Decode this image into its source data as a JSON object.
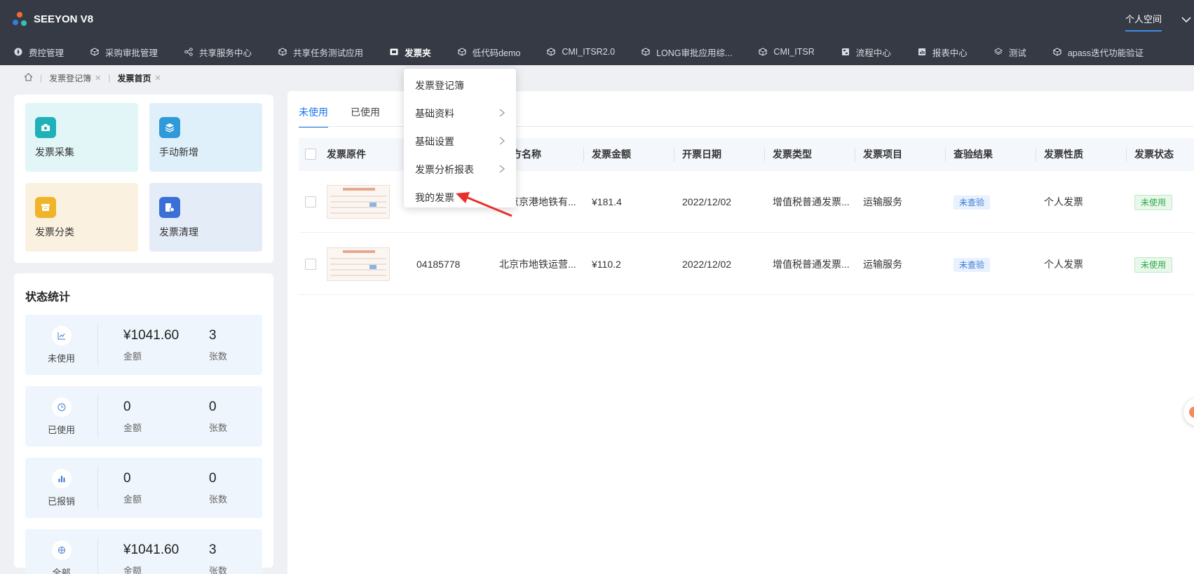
{
  "brand": {
    "name": "SEEYON V8"
  },
  "topbar": {
    "personal_space": "个人空间"
  },
  "nav": {
    "items": [
      {
        "label": "费控管理",
        "icon": "compass-icon"
      },
      {
        "label": "采购审批管理",
        "icon": "cube-icon"
      },
      {
        "label": "共享服务中心",
        "icon": "share-icon"
      },
      {
        "label": "共享任务测试应用",
        "icon": "cube-icon"
      },
      {
        "label": "发票夹",
        "icon": "invoice-folder-icon"
      },
      {
        "label": "低代码demo",
        "icon": "cube-icon"
      },
      {
        "label": "CMI_ITSR2.0",
        "icon": "cube-icon"
      },
      {
        "label": "LONG审批应用综...",
        "icon": "cube-icon"
      },
      {
        "label": "CMI_ITSR",
        "icon": "cube-icon"
      },
      {
        "label": "流程中心",
        "icon": "flow-icon"
      },
      {
        "label": "报表中心",
        "icon": "report-icon"
      },
      {
        "label": "测试",
        "icon": "layers-icon"
      },
      {
        "label": "apass迭代功能验证",
        "icon": "cube-icon"
      }
    ]
  },
  "breadcrumb": {
    "items": [
      {
        "label": "发票登记簿"
      },
      {
        "label": "发票首页"
      }
    ]
  },
  "quick_actions": [
    {
      "label": "发票采集",
      "icon": "camera-icon",
      "color": "#1fb0b8",
      "bg": "#e2f5f7"
    },
    {
      "label": "手动新增",
      "icon": "stack-icon",
      "color": "#2f9ad9",
      "bg": "#dff0fa"
    },
    {
      "label": "发票分类",
      "icon": "box-icon",
      "color": "#f0b429",
      "bg": "#fbf1e0"
    },
    {
      "label": "发票清理",
      "icon": "clean-icon",
      "color": "#3a6fd8",
      "bg": "#e4ecf8"
    }
  ],
  "stats": {
    "title": "状态统计",
    "rows": [
      {
        "name": "未使用",
        "icon": "trend-icon",
        "amount": "¥1041.60",
        "amount_label": "金额",
        "count": "3",
        "count_label": "张数"
      },
      {
        "name": "已使用",
        "icon": "clock-icon",
        "amount": "0",
        "amount_label": "金额",
        "count": "0",
        "count_label": "张数"
      },
      {
        "name": "已报销",
        "icon": "bars-icon",
        "amount": "0",
        "amount_label": "金额",
        "count": "0",
        "count_label": "张数"
      },
      {
        "name": "全部",
        "icon": "globe-icon",
        "amount": "¥1041.60",
        "amount_label": "金额",
        "count": "3",
        "count_label": "张数"
      }
    ]
  },
  "tabs": [
    {
      "label": "未使用",
      "active": true
    },
    {
      "label": "已使用",
      "active": false
    }
  ],
  "table": {
    "headers": [
      "发票原件",
      "方名称",
      "发票金额",
      "开票日期",
      "发票类型",
      "发票项目",
      "查验结果",
      "发票性质",
      "发票状态"
    ],
    "rows": [
      {
        "invoice_no": "",
        "seller": "北京京港地铁有...",
        "amount": "¥181.4",
        "date": "2022/12/02",
        "type": "增值税普通发票...",
        "item": "运输服务",
        "check": "未查验",
        "nature": "个人发票",
        "status": "未使用"
      },
      {
        "invoice_no": "04185778",
        "seller": "北京市地铁运营...",
        "amount": "¥110.2",
        "date": "2022/12/02",
        "type": "增值税普通发票...",
        "item": "运输服务",
        "check": "未查验",
        "nature": "个人发票",
        "status": "未使用"
      }
    ],
    "thumb_title": "地铁电子普通发票"
  },
  "dropdown": {
    "items": [
      {
        "label": "发票登记簿",
        "has_sub": false
      },
      {
        "label": "基础资料",
        "has_sub": true
      },
      {
        "label": "基础设置",
        "has_sub": true
      },
      {
        "label": "发票分析报表",
        "has_sub": true
      },
      {
        "label": "我的发票",
        "has_sub": false
      }
    ]
  }
}
